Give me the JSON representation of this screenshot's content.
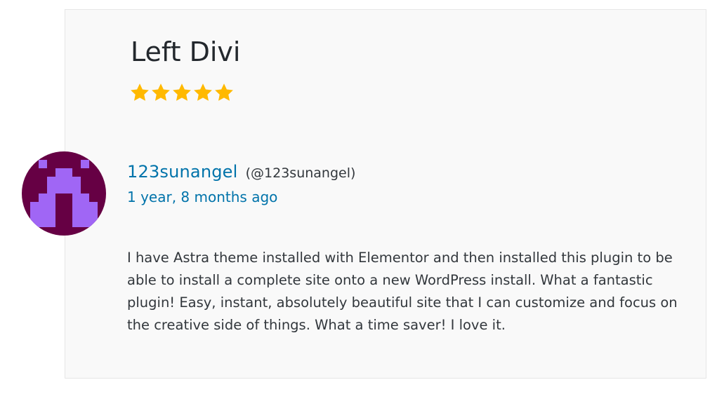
{
  "review": {
    "title": "Left Divi",
    "rating": 5,
    "rating_max": 5,
    "star_color": "#ffb900",
    "author": {
      "display_name": "123sunangel",
      "username": "(@123sunangel)",
      "avatar_colors": [
        "#660044",
        "#a066f5"
      ]
    },
    "date": "1 year, 8 months ago",
    "body": "I have Astra theme installed with Elementor and then installed this plugin to be able to install a complete site onto a new WordPress install. What a fantastic plugin! Easy, instant, absolutely beautiful site that I can customize and focus on the creative side of things. What a time saver! I love it."
  },
  "colors": {
    "link": "#0073aa",
    "text": "#32373c",
    "card_bg": "#f9f9f9"
  }
}
